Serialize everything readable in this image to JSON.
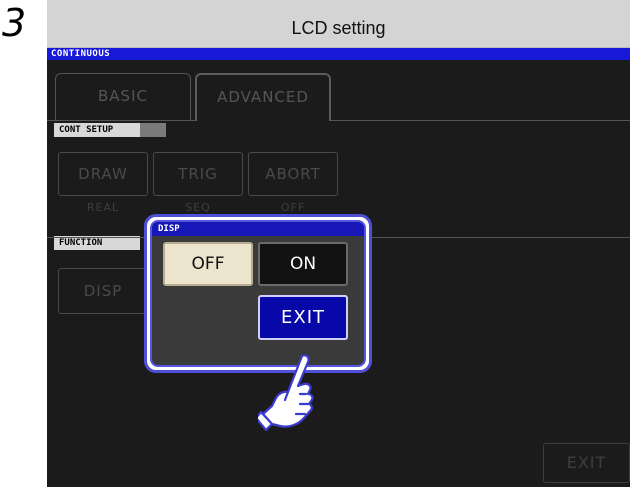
{
  "step_number": "3",
  "header": {
    "title": "LCD setting"
  },
  "screen": {
    "mode_bar": "CONTINUOUS",
    "tabs": [
      {
        "label": "BASIC"
      },
      {
        "label": "ADVANCED"
      }
    ],
    "cont_setup": {
      "label": "CONT SETUP",
      "buttons": [
        {
          "label": "DRAW",
          "value": "REAL"
        },
        {
          "label": "TRIG",
          "value": "SEQ"
        },
        {
          "label": "ABORT",
          "value": "OFF"
        }
      ]
    },
    "function": {
      "label": "FUNCTION",
      "buttons": [
        {
          "label": "DISP"
        }
      ]
    },
    "exit_label": "EXIT"
  },
  "dialog": {
    "title": "DISP",
    "off_label": "OFF",
    "on_label": "ON",
    "exit_label": "EXIT",
    "selected": "ON"
  },
  "icons": {
    "pointer": "pointing-hand-icon"
  },
  "colors": {
    "title_bar": "#1818d8",
    "dialog_border": "#4f4fd8",
    "exit_button": "#0808a8",
    "off_button": "#ece4cc"
  }
}
